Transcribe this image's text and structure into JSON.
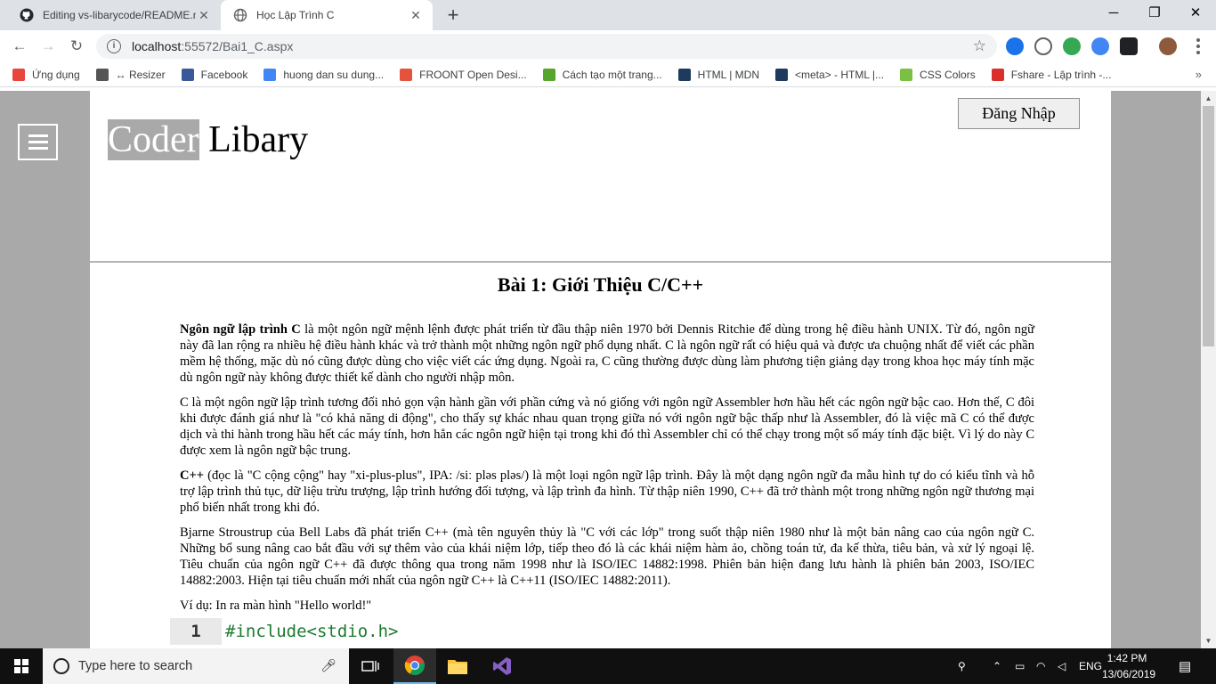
{
  "browser": {
    "tabs": [
      {
        "title": "Editing vs-libarycode/README.m",
        "active": false
      },
      {
        "title": "Học Lập Trình C",
        "active": true
      }
    ],
    "url_host": "localhost",
    "url_path": ":55572/Bai1_C.aspx",
    "bookmarks": [
      {
        "label": "Ứng dụng",
        "icon": "apps-icon",
        "color": "#e8453c"
      },
      {
        "label": "↔ Resizer",
        "icon": "resizer-icon",
        "color": "#555555"
      },
      {
        "label": "Facebook",
        "icon": "facebook-icon",
        "color": "#3b5998"
      },
      {
        "label": "huong dan su dung...",
        "icon": "google-icon",
        "color": "#4285f4"
      },
      {
        "label": "FROONT Open Desi...",
        "icon": "froont-icon",
        "color": "#e5533d"
      },
      {
        "label": "Cách tạo một trang...",
        "icon": "w-icon",
        "color": "#56a52c"
      },
      {
        "label": "HTML | MDN",
        "icon": "mdn-icon",
        "color": "#1f3a5f"
      },
      {
        "label": "<meta> - HTML |...",
        "icon": "mdn-icon",
        "color": "#1f3a5f"
      },
      {
        "label": "CSS Colors",
        "icon": "css-icon",
        "color": "#7bc043"
      },
      {
        "label": "Fshare - Lập trình -...",
        "icon": "fshare-icon",
        "color": "#d9302c"
      }
    ]
  },
  "site": {
    "logo_part1": "Coder",
    "logo_part2": " Libary",
    "login_label": "Đăng Nhập",
    "lesson_title": "Bài 1: Giới Thiệu C/C++",
    "paragraphs": [
      {
        "bold": "Ngôn ngữ lập trình C",
        "text": " là một ngôn ngữ mệnh lệnh được phát triển từ đầu thập niên 1970 bởi Dennis Ritchie để dùng trong hệ điều hành UNIX. Từ đó, ngôn ngữ này đã lan rộng ra nhiều hệ điều hành khác và trở thành một những ngôn ngữ phổ dụng nhất. C là ngôn ngữ rất có hiệu quả và được ưa chuộng nhất để viết các phần mềm hệ thống, mặc dù nó cũng được dùng cho việc viết các ứng dụng. Ngoài ra, C cũng thường được dùng làm phương tiện giảng dạy trong khoa học máy tính mặc dù ngôn ngữ này không được thiết kế dành cho người nhập môn."
      },
      {
        "bold": "",
        "text": "C là một ngôn ngữ lập trình tương đối nhỏ gọn vận hành gần với phần cứng và nó giống với ngôn ngữ Assembler hơn hầu hết các ngôn ngữ bậc cao. Hơn thế, C đôi khi được đánh giá như là \"có khả năng di động\", cho thấy sự khác nhau quan trọng giữa nó với ngôn ngữ bậc thấp như là Assembler, đó là việc mã C có thể được dịch và thi hành trong hầu hết các máy tính, hơn hẳn các ngôn ngữ hiện tại trong khi đó thì Assembler chỉ có thể chạy trong một số máy tính đặc biệt. Vì lý do này C được xem là ngôn ngữ bậc trung."
      },
      {
        "bold": "C++",
        "text": " (đọc là \"C cộng cộng\" hay \"xi-plus-plus\", IPA: /siː pləs pləs/) là một loại ngôn ngữ lập trình. Đây là một dạng ngôn ngữ đa mẫu hình tự do có kiểu tĩnh và hỗ trợ lập trình thủ tục, dữ liệu trừu trượng, lập trình hướng đối tượng, và lập trình đa hình. Từ thập niên 1990, C++ đã trở thành một trong những ngôn ngữ thương mại phổ biến nhất trong khi đó."
      },
      {
        "bold": "",
        "text": "Bjarne Stroustrup của Bell Labs đã phát triển C++ (mà tên nguyên thủy là \"C với các lớp\" trong suốt thập niên 1980 như là một bản nâng cao của ngôn ngữ C. Những bổ sung nâng cao bắt đầu với sự thêm vào của khái niệm lớp, tiếp theo đó là các khái niệm hàm ảo, chồng toán tử, đa kế thừa, tiêu bản, và xử lý ngoại lệ. Tiêu chuẩn của ngôn ngữ C++ đã được thông qua trong năm 1998 như là ISO/IEC 14882:1998. Phiên bản hiện đang lưu hành là phiên bản 2003, ISO/IEC 14882:2003. Hiện tại tiêu chuẩn mới nhất của ngôn ngữ C++ là C++11 (ISO/IEC 14882:2011)."
      }
    ],
    "example_label": "Ví dụ: In ra màn hình \"Hello world!\"",
    "code_line_number": "1",
    "code_line": "#include<stdio.h>"
  },
  "taskbar": {
    "search_placeholder": "Type here to search",
    "language": "ENG",
    "time": "1:42 PM",
    "date": "13/06/2019"
  }
}
